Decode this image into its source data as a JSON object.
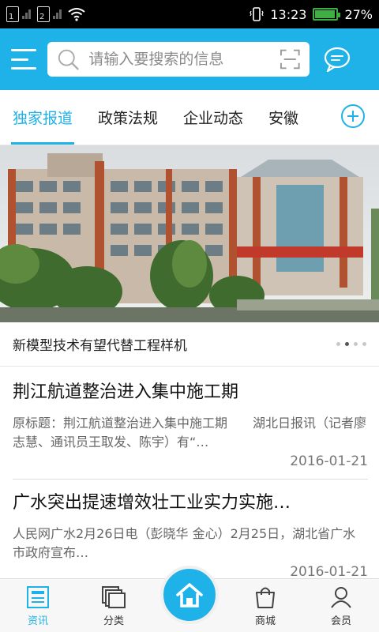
{
  "status_bar": {
    "sim1": "1",
    "sim2": "2",
    "time": "13:23",
    "battery": "27%"
  },
  "header": {
    "search_placeholder": "请输入要搜索的信息"
  },
  "tabs": [
    {
      "label": "独家报道",
      "active": true
    },
    {
      "label": "政策法规",
      "active": false
    },
    {
      "label": "企业动态",
      "active": false
    },
    {
      "label": "安徽",
      "active": false
    }
  ],
  "banner": {
    "caption": "新模型技术有望代替工程样机",
    "dots": 4,
    "active_dot": 2
  },
  "news": [
    {
      "title": "荆江航道整治进入集中施工期",
      "summary": "原标题：荆江航道整治进入集中施工期　　湖北日报讯（记者廖志慧、通讯员王取发、陈宇）有“…",
      "date": "2016-01-21"
    },
    {
      "title": "广水突出提速增效壮工业实力实施…",
      "summary": "人民网广水2月26日电（彭晓华 金心）2月25日，湖北省广水市政府宣布…",
      "date": "2016-01-21"
    }
  ],
  "bottom_nav": [
    {
      "label": "资讯",
      "icon": "news-icon",
      "active": true
    },
    {
      "label": "分类",
      "icon": "category-icon",
      "active": false
    },
    {
      "label": "",
      "icon": "home-icon",
      "active": false
    },
    {
      "label": "商城",
      "icon": "shopping-bag-icon",
      "active": false
    },
    {
      "label": "会员",
      "icon": "user-icon",
      "active": false
    }
  ],
  "colors": {
    "accent": "#1fb2e8",
    "battery": "#3cb043"
  }
}
